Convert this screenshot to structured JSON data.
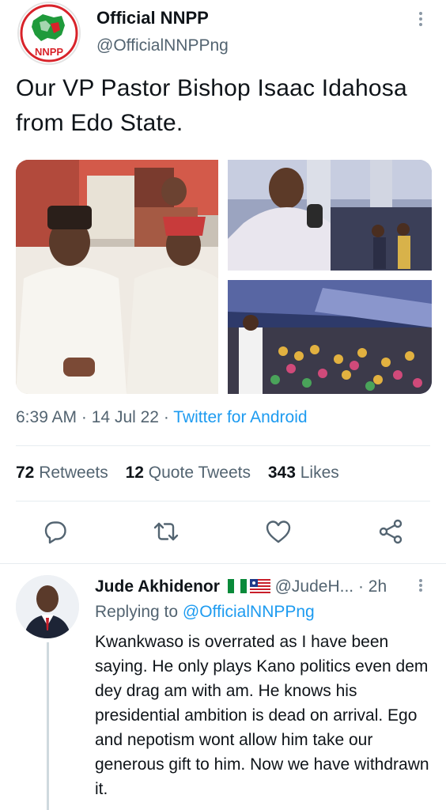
{
  "account": {
    "display_name": "Official NNPP",
    "handle": "@OfficialNNPPng",
    "logo_text": "NNPP"
  },
  "tweet": {
    "text": "Our VP Pastor Bishop Isaac Idahosa from Edo State.",
    "time": "6:39 AM",
    "date": "14 Jul 22",
    "source": "Twitter for Android",
    "separator": "·"
  },
  "stats": {
    "retweets_count": "72",
    "retweets_label": "Retweets",
    "quotes_count": "12",
    "quotes_label": "Quote Tweets",
    "likes_count": "343",
    "likes_label": "Likes"
  },
  "reply": {
    "name": "Jude Akhidenor",
    "handle": "@JudeH...",
    "time": "· 2h",
    "replying_prefix": "Replying to ",
    "replying_to": "@OfficialNNPPng",
    "text": "Kwankwaso is overrated as I have been saying. He only plays Kano politics even dem dey drag am with am. He knows his presidential ambition is dead on arrival. Ego and nepotism wont allow him take our generous gift to him. Now we have withdrawn it."
  },
  "colors": {
    "link": "#1d9bf0",
    "secondary": "#536471",
    "nnpp_red": "#d8232a",
    "nnpp_green": "#1f9a3b"
  },
  "icons": [
    "more-icon",
    "reply-icon",
    "retweet-icon",
    "like-icon",
    "share-icon"
  ]
}
